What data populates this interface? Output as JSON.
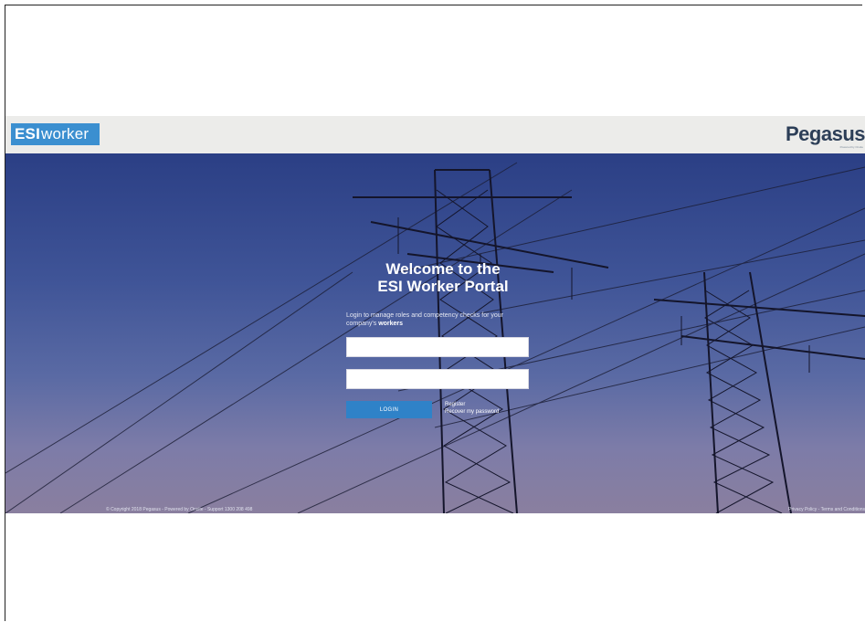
{
  "header": {
    "esi_logo_bold": "ESI",
    "esi_logo_text": "worker",
    "pegasus_logo": "Pegasus",
    "pegasus_tagline": "Powered by Onsite"
  },
  "hero": {
    "welcome_line1": "Welcome to the",
    "welcome_line2": "ESI Worker Portal",
    "intro_text": "Login to manage roles and competency checks for your company's",
    "intro_bold": "workers",
    "username_placeholder": "",
    "password_placeholder": "",
    "login_label": "LOGIN",
    "register_link": "Register",
    "recover_link": "Recover my password"
  },
  "footer": {
    "copyright": "© Copyright 2018 Pegasus - Powered by Onsite - Support 1300 208 498",
    "legal": "Privacy Policy - Terms and Conditions"
  },
  "colors": {
    "accent": "#2f82c8",
    "esi_logo": "#3b8fd0",
    "header_bg": "#ececea",
    "sky_top": "#2b3f85",
    "sky_bottom": "#8a7f9f"
  }
}
